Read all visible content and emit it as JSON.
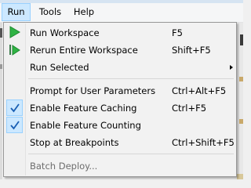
{
  "menubar": {
    "items": [
      {
        "label": "Run"
      },
      {
        "label": "Tools"
      },
      {
        "label": "Help"
      }
    ]
  },
  "run_menu": {
    "items": [
      {
        "label": "Run Workspace",
        "shortcut": "F5",
        "icon": "play-icon"
      },
      {
        "label": "Rerun Entire Workspace",
        "shortcut": "Shift+F5",
        "icon": "rerun-icon"
      },
      {
        "label": "Run Selected",
        "has_submenu": true
      },
      {
        "label": "Prompt for User Parameters",
        "shortcut": "Ctrl+Alt+F5"
      },
      {
        "label": "Enable Feature Caching",
        "shortcut": "Ctrl+F5",
        "checked": true
      },
      {
        "label": "Enable Feature Counting",
        "checked": true
      },
      {
        "label": "Stop at Breakpoints",
        "shortcut": "Ctrl+Shift+F5"
      },
      {
        "label": "Batch Deploy...",
        "disabled": true
      }
    ]
  },
  "colors": {
    "play_green": "#2fb344",
    "check_blue": "#1a5fb4",
    "highlight": "#cce8ff",
    "highlight_border": "#99d1ff"
  }
}
